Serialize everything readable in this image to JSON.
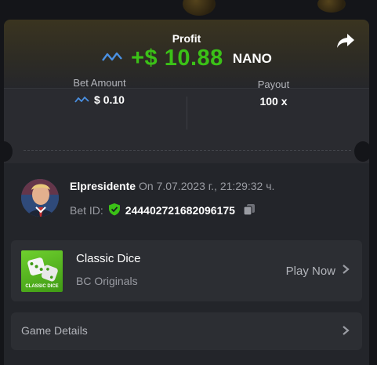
{
  "profit": {
    "label": "Profit",
    "value": "+$ 10.88",
    "currency": "NANO"
  },
  "bet_amount": {
    "label": "Bet Amount",
    "value": "$ 0.10"
  },
  "payout": {
    "label": "Payout",
    "value": "100 x"
  },
  "user": {
    "name": "Elpresidente",
    "date": "On 7.07.2023 г., 21:29:32 ч."
  },
  "bet": {
    "label": "Bet ID:",
    "id": "244402721682096175"
  },
  "game": {
    "title": "Classic Dice",
    "subtitle": "BC Originals",
    "thumb_text": "CLASSIC DICE",
    "play_label": "Play Now"
  },
  "details": {
    "label": "Game Details"
  },
  "colors": {
    "profit_green": "#3bc117",
    "nano_blue": "#4a90e2",
    "shield_green": "#3bc117"
  }
}
